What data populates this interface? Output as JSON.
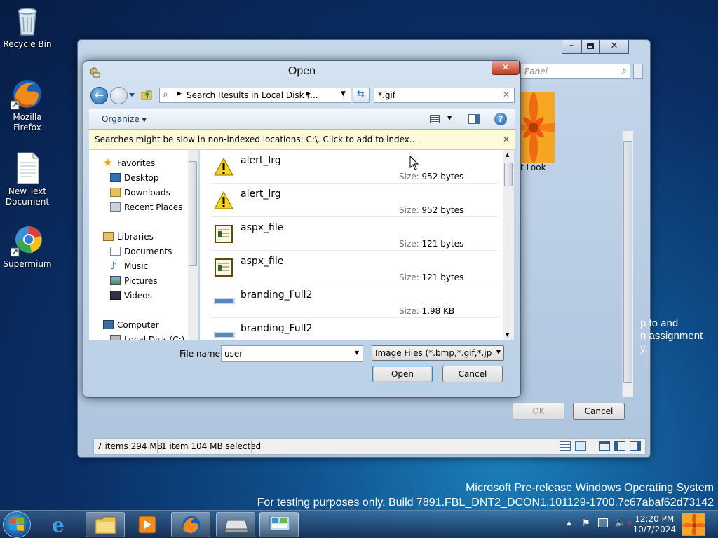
{
  "desktop": {
    "icons": [
      {
        "label": "Recycle Bin",
        "icon": "recycle-bin-icon"
      },
      {
        "label": "Mozilla Firefox",
        "icon": "firefox-icon"
      },
      {
        "label": "New Text Document",
        "icon": "text-document-icon"
      },
      {
        "label": "Supermium",
        "icon": "supermium-icon"
      }
    ]
  },
  "watermark": {
    "line1": "Microsoft Pre-release Windows Operating System",
    "line2": "For testing purposes only. Build 7891.FBL_DNT2_DCON1.101129-1700.7c67abaf62d73142"
  },
  "background_window": {
    "search_placeholder": "Panel",
    "picture_caption": "rt Look",
    "side_text_line1": "p to and",
    "side_text_line2": "n assignment",
    "side_text_line3": "y.",
    "ok_label": "OK",
    "cancel_label": "Cancel",
    "status_items": "7 items 294 MB",
    "status_selected": "1 item 104 MB selected"
  },
  "dialog": {
    "title": "Open",
    "address_path": "Search Results in Local Disk (...",
    "search_value": "*.gif",
    "organize_label": "Organize",
    "info_message": "Searches might be slow in non-indexed locations: C:\\. Click to add to index...",
    "nav": {
      "favorites": "Favorites",
      "desktop": "Desktop",
      "downloads": "Downloads",
      "recent_places": "Recent Places",
      "libraries": "Libraries",
      "documents": "Documents",
      "music": "Music",
      "pictures": "Pictures",
      "videos": "Videos",
      "computer": "Computer",
      "local_disk": "Local Disk (C:)"
    },
    "files": [
      {
        "name": "alert_lrg",
        "size_label": "Size:",
        "size": "952 bytes",
        "icon": "warning-icon"
      },
      {
        "name": "alert_lrg",
        "size_label": "Size:",
        "size": "952 bytes",
        "icon": "warning-icon"
      },
      {
        "name": "aspx_file",
        "size_label": "Size:",
        "size": "121 bytes",
        "icon": "aspx-file-icon"
      },
      {
        "name": "aspx_file",
        "size_label": "Size:",
        "size": "121 bytes",
        "icon": "aspx-file-icon"
      },
      {
        "name": "branding_Full2",
        "size_label": "Size:",
        "size": "1.98 KB",
        "icon": "image-file-icon"
      },
      {
        "name": "branding_Full2",
        "size_label": "",
        "size": "",
        "icon": "image-file-icon"
      }
    ],
    "filename_label": "File name:",
    "filename_value": "user",
    "filter_value": "Image Files (*.bmp,*.gif,*.jpg,*.j",
    "open_label": "Open",
    "cancel_label": "Cancel"
  },
  "taskbar": {
    "time": "12:20 PM",
    "date": "10/7/2024"
  },
  "colors": {
    "dialog_frame": "#c1d5ea",
    "info_bar": "#fdfbd9",
    "desktop": "#0a2f66"
  }
}
